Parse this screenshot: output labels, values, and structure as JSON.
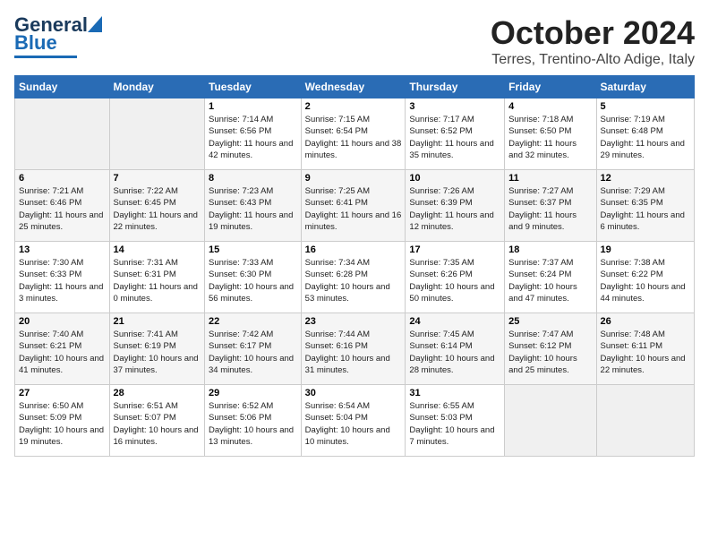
{
  "logo": {
    "line1": "General",
    "line2": "Blue"
  },
  "title": "October 2024",
  "subtitle": "Terres, Trentino-Alto Adige, Italy",
  "weekdays": [
    "Sunday",
    "Monday",
    "Tuesday",
    "Wednesday",
    "Thursday",
    "Friday",
    "Saturday"
  ],
  "weeks": [
    [
      {
        "day": "",
        "detail": ""
      },
      {
        "day": "",
        "detail": ""
      },
      {
        "day": "1",
        "detail": "Sunrise: 7:14 AM\nSunset: 6:56 PM\nDaylight: 11 hours and 42 minutes."
      },
      {
        "day": "2",
        "detail": "Sunrise: 7:15 AM\nSunset: 6:54 PM\nDaylight: 11 hours and 38 minutes."
      },
      {
        "day": "3",
        "detail": "Sunrise: 7:17 AM\nSunset: 6:52 PM\nDaylight: 11 hours and 35 minutes."
      },
      {
        "day": "4",
        "detail": "Sunrise: 7:18 AM\nSunset: 6:50 PM\nDaylight: 11 hours and 32 minutes."
      },
      {
        "day": "5",
        "detail": "Sunrise: 7:19 AM\nSunset: 6:48 PM\nDaylight: 11 hours and 29 minutes."
      }
    ],
    [
      {
        "day": "6",
        "detail": "Sunrise: 7:21 AM\nSunset: 6:46 PM\nDaylight: 11 hours and 25 minutes."
      },
      {
        "day": "7",
        "detail": "Sunrise: 7:22 AM\nSunset: 6:45 PM\nDaylight: 11 hours and 22 minutes."
      },
      {
        "day": "8",
        "detail": "Sunrise: 7:23 AM\nSunset: 6:43 PM\nDaylight: 11 hours and 19 minutes."
      },
      {
        "day": "9",
        "detail": "Sunrise: 7:25 AM\nSunset: 6:41 PM\nDaylight: 11 hours and 16 minutes."
      },
      {
        "day": "10",
        "detail": "Sunrise: 7:26 AM\nSunset: 6:39 PM\nDaylight: 11 hours and 12 minutes."
      },
      {
        "day": "11",
        "detail": "Sunrise: 7:27 AM\nSunset: 6:37 PM\nDaylight: 11 hours and 9 minutes."
      },
      {
        "day": "12",
        "detail": "Sunrise: 7:29 AM\nSunset: 6:35 PM\nDaylight: 11 hours and 6 minutes."
      }
    ],
    [
      {
        "day": "13",
        "detail": "Sunrise: 7:30 AM\nSunset: 6:33 PM\nDaylight: 11 hours and 3 minutes."
      },
      {
        "day": "14",
        "detail": "Sunrise: 7:31 AM\nSunset: 6:31 PM\nDaylight: 11 hours and 0 minutes."
      },
      {
        "day": "15",
        "detail": "Sunrise: 7:33 AM\nSunset: 6:30 PM\nDaylight: 10 hours and 56 minutes."
      },
      {
        "day": "16",
        "detail": "Sunrise: 7:34 AM\nSunset: 6:28 PM\nDaylight: 10 hours and 53 minutes."
      },
      {
        "day": "17",
        "detail": "Sunrise: 7:35 AM\nSunset: 6:26 PM\nDaylight: 10 hours and 50 minutes."
      },
      {
        "day": "18",
        "detail": "Sunrise: 7:37 AM\nSunset: 6:24 PM\nDaylight: 10 hours and 47 minutes."
      },
      {
        "day": "19",
        "detail": "Sunrise: 7:38 AM\nSunset: 6:22 PM\nDaylight: 10 hours and 44 minutes."
      }
    ],
    [
      {
        "day": "20",
        "detail": "Sunrise: 7:40 AM\nSunset: 6:21 PM\nDaylight: 10 hours and 41 minutes."
      },
      {
        "day": "21",
        "detail": "Sunrise: 7:41 AM\nSunset: 6:19 PM\nDaylight: 10 hours and 37 minutes."
      },
      {
        "day": "22",
        "detail": "Sunrise: 7:42 AM\nSunset: 6:17 PM\nDaylight: 10 hours and 34 minutes."
      },
      {
        "day": "23",
        "detail": "Sunrise: 7:44 AM\nSunset: 6:16 PM\nDaylight: 10 hours and 31 minutes."
      },
      {
        "day": "24",
        "detail": "Sunrise: 7:45 AM\nSunset: 6:14 PM\nDaylight: 10 hours and 28 minutes."
      },
      {
        "day": "25",
        "detail": "Sunrise: 7:47 AM\nSunset: 6:12 PM\nDaylight: 10 hours and 25 minutes."
      },
      {
        "day": "26",
        "detail": "Sunrise: 7:48 AM\nSunset: 6:11 PM\nDaylight: 10 hours and 22 minutes."
      }
    ],
    [
      {
        "day": "27",
        "detail": "Sunrise: 6:50 AM\nSunset: 5:09 PM\nDaylight: 10 hours and 19 minutes."
      },
      {
        "day": "28",
        "detail": "Sunrise: 6:51 AM\nSunset: 5:07 PM\nDaylight: 10 hours and 16 minutes."
      },
      {
        "day": "29",
        "detail": "Sunrise: 6:52 AM\nSunset: 5:06 PM\nDaylight: 10 hours and 13 minutes."
      },
      {
        "day": "30",
        "detail": "Sunrise: 6:54 AM\nSunset: 5:04 PM\nDaylight: 10 hours and 10 minutes."
      },
      {
        "day": "31",
        "detail": "Sunrise: 6:55 AM\nSunset: 5:03 PM\nDaylight: 10 hours and 7 minutes."
      },
      {
        "day": "",
        "detail": ""
      },
      {
        "day": "",
        "detail": ""
      }
    ]
  ]
}
